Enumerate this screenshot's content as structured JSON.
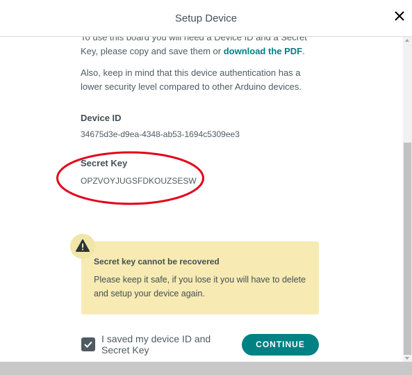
{
  "header": {
    "title": "Setup Device"
  },
  "intro": {
    "text": "To use this board you will need a Device ID and a Secret Key, please copy and save them or ",
    "link": "download the PDF",
    "suffix": "."
  },
  "note": "Also, keep in mind that this device authentication has a lower security level compared to other Arduino devices.",
  "device_id": {
    "label": "Device ID",
    "value": "34675d3e-d9ea-4348-ab53-1694c5309ee3"
  },
  "secret_key": {
    "label": "Secret Key",
    "value": "OPZVOYJUGSFDKOUZSESW"
  },
  "warning": {
    "title": "Secret key cannot be recovered",
    "text": "Please keep it safe, if you lose it you will have to delete and setup your device again."
  },
  "confirm": {
    "label": "I saved my device ID and Secret Key",
    "checked": true
  },
  "continue_label": "CONTINUE",
  "colors": {
    "accent": "#008184",
    "warning_bg": "#f7eab3",
    "highlight_ellipse": "#e3001b"
  }
}
